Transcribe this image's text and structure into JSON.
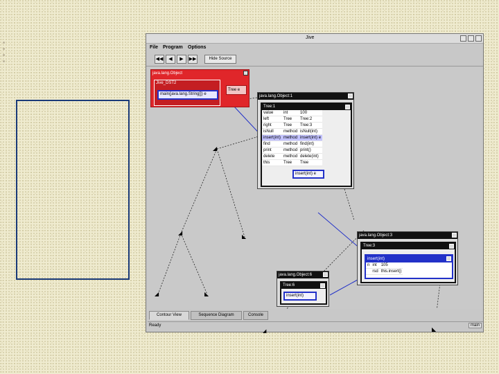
{
  "window": {
    "title": "Jive"
  },
  "menu": {
    "file": "File",
    "program": "Program",
    "options": "Options"
  },
  "toolbar": {
    "step_back_all": "◀◀",
    "step_back": "◀",
    "step_forward": "▶",
    "step_forward_all": "▶▶",
    "hide_source": "Hide Source"
  },
  "objects": {
    "main_object": {
      "header": "java.lang.Object",
      "class_header": "Jive_DST2",
      "method": "main(java.lang.String[]) e",
      "tree_field": "Tree e"
    },
    "object1": {
      "header": "java.lang.Object:1",
      "class_header": "Tree:1",
      "rows": [
        [
          "value",
          "int",
          "100"
        ],
        [
          "left",
          "Tree",
          "Tree:2"
        ],
        [
          "right",
          "Tree",
          "Tree:3"
        ],
        [
          "isNull",
          "method",
          "isNull(int)"
        ],
        [
          "insert(int)",
          "method",
          "insert(int) e"
        ],
        [
          "find",
          "method",
          "find(int)"
        ],
        [
          "print",
          "method",
          "print()"
        ],
        [
          "delete",
          "method",
          "delete(int)"
        ],
        [
          "this",
          "Tree",
          "Tree"
        ]
      ],
      "highlight_row": 4,
      "call_button": "insert(int) e"
    },
    "object3": {
      "header": "java.lang.Object:3",
      "class_header": "Tree:3",
      "method_header": "insert(int)",
      "rows": [
        [
          "n",
          "int",
          "105"
        ],
        [
          "",
          "rsd",
          "this.insert()"
        ]
      ]
    },
    "object6": {
      "header": "java.lang.Object:6",
      "class_header": "Tree:6",
      "call_button": "insert(int)"
    }
  },
  "tabs": [
    {
      "label": "Contour View",
      "active": true
    },
    {
      "label": "Sequence Diagram",
      "active": false
    },
    {
      "label": "Console",
      "active": false
    }
  ],
  "status": {
    "text": "Ready",
    "thread": "main"
  },
  "colors": {
    "accent_red": "#e0262a",
    "accent_blue": "#2231c8",
    "page_bg": "#efebcf",
    "frame": "#1a3a78"
  },
  "icons": {
    "close": "close-icon",
    "leaf": "leaf-node-icon"
  }
}
